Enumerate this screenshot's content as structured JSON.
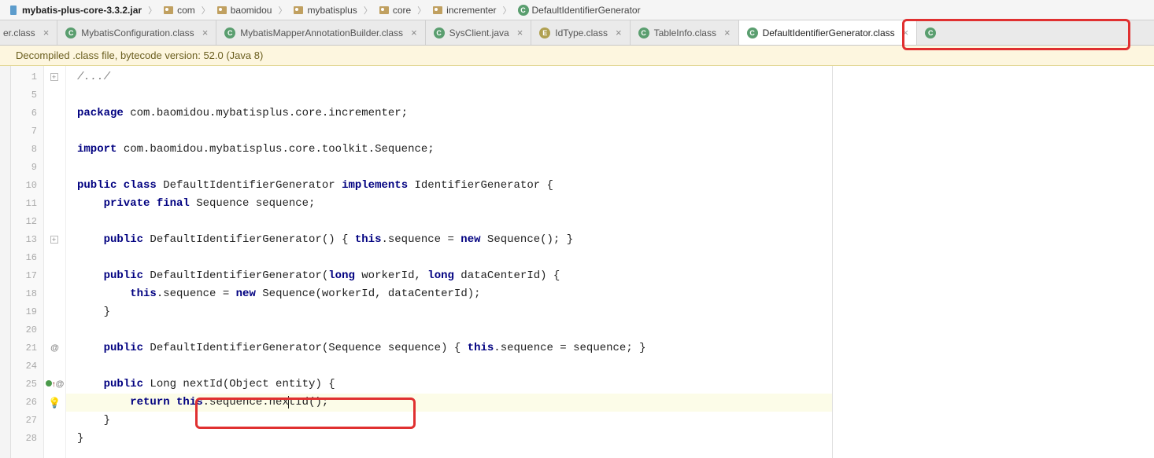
{
  "breadcrumb": {
    "jar": "mybatis-plus-core-3.3.2.jar",
    "parts": [
      "com",
      "baomidou",
      "mybatisplus",
      "core",
      "incrementer"
    ],
    "class_name": "DefaultIdentifierGenerator"
  },
  "tab_partial_left": "er.class",
  "tabs": [
    {
      "label": "MybatisConfiguration.class",
      "icon": "c"
    },
    {
      "label": "MybatisMapperAnnotationBuilder.class",
      "icon": "c"
    },
    {
      "label": "SysClient.java",
      "icon": "c"
    },
    {
      "label": "IdType.class",
      "icon": "e"
    },
    {
      "label": "TableInfo.class",
      "icon": "c"
    },
    {
      "label": "DefaultIdentifierGenerator.class",
      "icon": "c",
      "active": true
    }
  ],
  "tab_partial_right": "C",
  "banner": "Decompiled .class file, bytecode version: 52.0 (Java 8)",
  "gutter_lines": [
    "1",
    "5",
    "6",
    "7",
    "8",
    "9",
    "10",
    "11",
    "12",
    "13",
    "16",
    "17",
    "18",
    "19",
    "20",
    "21",
    "24",
    "25",
    "26",
    "27",
    "28"
  ],
  "code": {
    "l1": "/.../",
    "l6_pkg": "package",
    "l6_rest": " com.baomidou.mybatisplus.core.incrementer;",
    "l8_imp": "import",
    "l8_rest": " com.baomidou.mybatisplus.core.toolkit.Sequence;",
    "l10_a": "public class",
    "l10_b": " DefaultIdentifierGenerator ",
    "l10_c": "implements",
    "l10_d": " IdentifierGenerator {",
    "l11_a": "    private final",
    "l11_b": " Sequence sequence;",
    "l13_a": "    public",
    "l13_b": " DefaultIdentifierGenerator() { ",
    "l13_c": "this",
    "l13_d": ".sequence = ",
    "l13_e": "new",
    "l13_f": " Sequence(); }",
    "l17_a": "    public",
    "l17_b": " DefaultIdentifierGenerator(",
    "l17_c": "long",
    "l17_d": " workerId, ",
    "l17_e": "long",
    "l17_f": " dataCenterId) {",
    "l18_a": "        this",
    "l18_b": ".sequence = ",
    "l18_c": "new",
    "l18_d": " Sequence(workerId, dataCenterId);",
    "l19": "    }",
    "l21_a": "    public",
    "l21_b": " DefaultIdentifierGenerator(Sequence sequence) { ",
    "l21_c": "this",
    "l21_d": ".sequence = sequence; }",
    "l25_a": "    public",
    "l25_b": " Long nextId(Object entity) {",
    "l26_a": "        return this",
    "l26_b": ".sequence.nex",
    "l26_c": "tId();",
    "l27": "    }",
    "l28": "}"
  },
  "marks": {
    "at": "@",
    "arrow": "↑",
    "fold_plus": "+",
    "fold_minus": "−"
  }
}
